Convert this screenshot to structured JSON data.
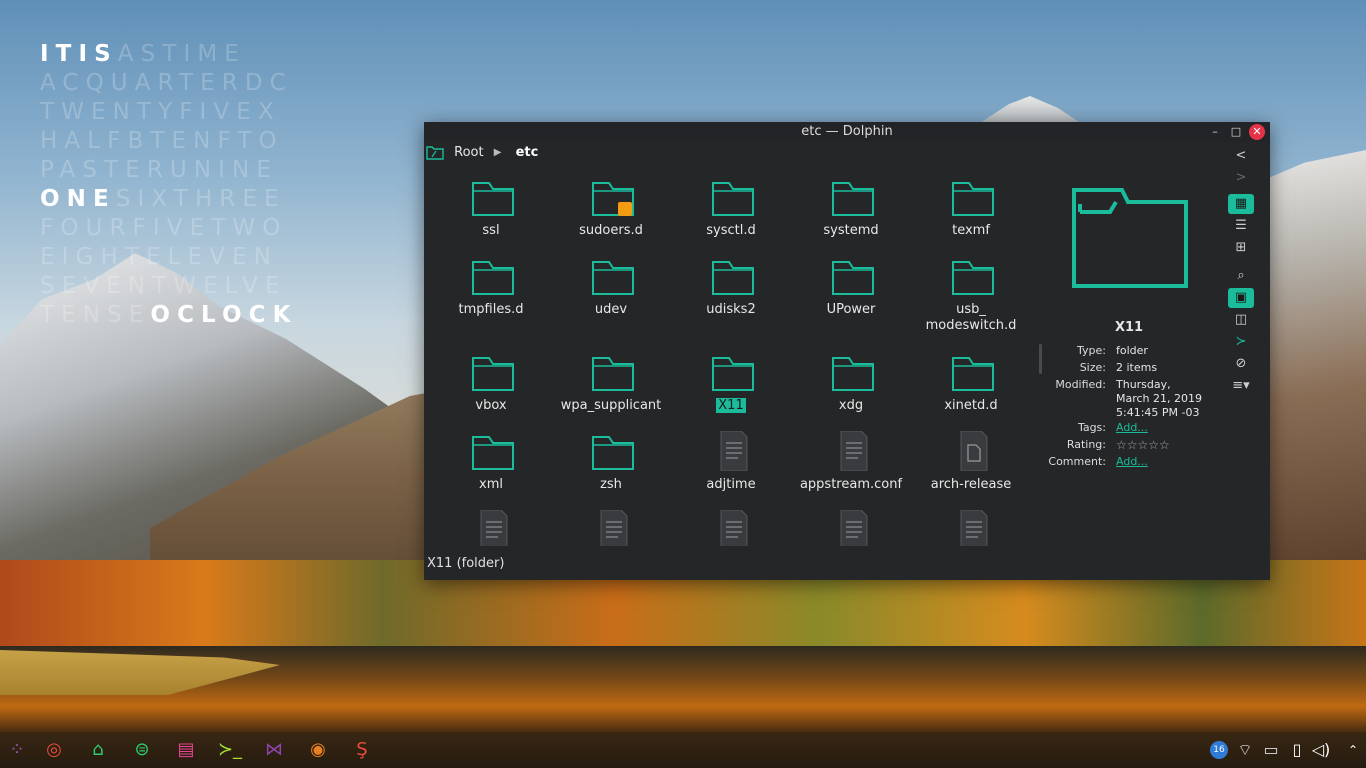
{
  "word_clock": {
    "rows": [
      {
        "lit": "IT",
        "gap": "",
        "lit2": "IS",
        "dim": "ASTIME"
      },
      {
        "dim": "ACQUARTERDC"
      },
      {
        "dim": "TWENTYFIVEX"
      },
      {
        "dim": "HALFBTENFTO"
      },
      {
        "dim": "PASTERUNINE"
      },
      {
        "lit": "ONE",
        "dim": "SIXTHREE"
      },
      {
        "dim": "FOURFIVETWO"
      },
      {
        "dim": "EIGHTELEVEN"
      },
      {
        "dim": "SEVENTWELVE"
      },
      {
        "dim": "TENSE",
        "lit": "OCLOCK"
      }
    ]
  },
  "window": {
    "title": "etc — Dolphin",
    "breadcrumb": {
      "root": "Root",
      "current": "etc"
    },
    "items": [
      {
        "name": "ssl",
        "kind": "folder"
      },
      {
        "name": "sudoers.d",
        "kind": "folder-locked"
      },
      {
        "name": "sysctl.d",
        "kind": "folder"
      },
      {
        "name": "systemd",
        "kind": "folder"
      },
      {
        "name": "texmf",
        "kind": "folder"
      },
      {
        "name": "tmpfiles.d",
        "kind": "folder"
      },
      {
        "name": "udev",
        "kind": "folder"
      },
      {
        "name": "udisks2",
        "kind": "folder"
      },
      {
        "name": "UPower",
        "kind": "folder"
      },
      {
        "name": "usb_",
        "name2": "modeswitch.d",
        "kind": "folder"
      },
      {
        "name": "vbox",
        "kind": "folder"
      },
      {
        "name": "wpa_supplicant",
        "kind": "folder"
      },
      {
        "name": "X11",
        "kind": "folder",
        "selected": true
      },
      {
        "name": "xdg",
        "kind": "folder"
      },
      {
        "name": "xinetd.d",
        "kind": "folder"
      },
      {
        "name": "xml",
        "kind": "folder"
      },
      {
        "name": "zsh",
        "kind": "folder"
      },
      {
        "name": "adjtime",
        "kind": "file"
      },
      {
        "name": "appstream.conf",
        "kind": "file"
      },
      {
        "name": "arch-release",
        "kind": "file-blank"
      },
      {
        "name": "",
        "kind": "file"
      },
      {
        "name": "",
        "kind": "file"
      },
      {
        "name": "",
        "kind": "file"
      },
      {
        "name": "",
        "kind": "file"
      },
      {
        "name": "",
        "kind": "file"
      }
    ],
    "status": "X11  (folder)",
    "info": {
      "title": "X11",
      "type_label": "Type:",
      "type_value": "folder",
      "size_label": "Size:",
      "size_value": "2  items",
      "modified_label": "Modified:",
      "modified_l1": "Thursday,",
      "modified_l2": "March 21, 2019",
      "modified_l3": "5:41:45  PM -03",
      "tags_label": "Tags:",
      "tags_value": "Add...",
      "rating_label": "Rating:",
      "rating_value": "☆☆☆☆☆",
      "comment_label": "Comment:",
      "comment_value": "Add..."
    },
    "toolbar_icons": [
      "back-icon",
      "forward-icon",
      "icons-view-icon",
      "compact-view-icon",
      "details-view-icon",
      "search-icon",
      "preview-icon",
      "split-icon",
      "terminal-icon",
      "hidden-files-icon",
      "menu-icon"
    ]
  },
  "taskbar": {
    "apps": [
      "app-launcher-icon",
      "firefox-icon",
      "file-manager-icon",
      "settings-icon",
      "text-editor-icon",
      "terminal-icon",
      "visual-studio-icon",
      "chrome-icon",
      "sublime-icon"
    ],
    "tray": {
      "badge": "16"
    }
  },
  "colors": {
    "accent": "#1abc9c",
    "window_bg": "#252628",
    "close": "#e5344a"
  }
}
